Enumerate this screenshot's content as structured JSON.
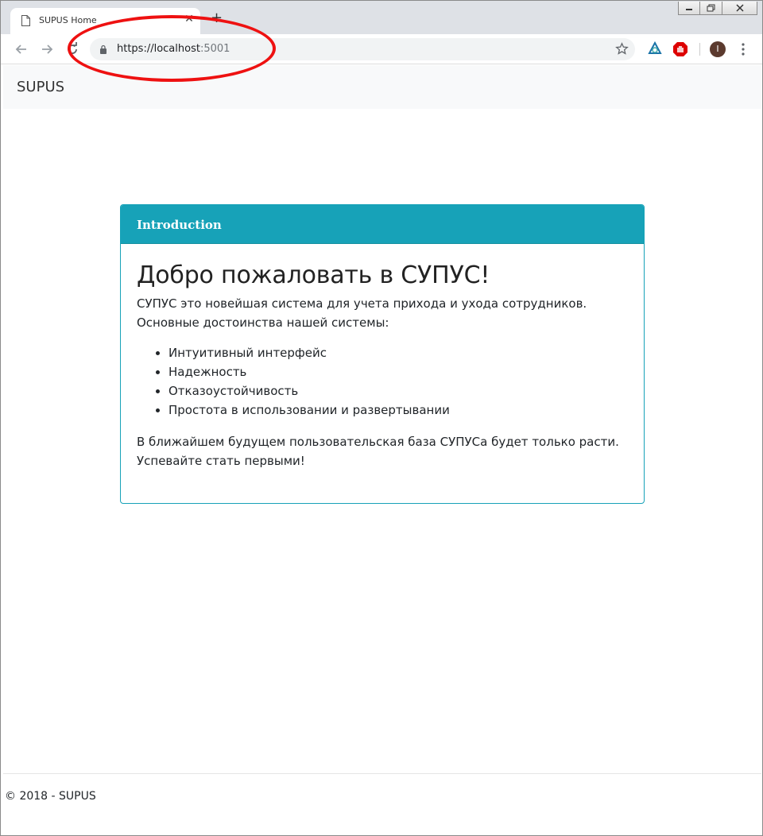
{
  "browser": {
    "tab_title": "SUPUS Home",
    "url_main": "https://localhost",
    "url_port": ":5001",
    "avatar_initial": "I"
  },
  "navbar": {
    "brand": "SUPUS"
  },
  "card": {
    "header": "Introduction",
    "heading": "Добро пожаловать в СУПУС!",
    "intro": "СУПУС это новейшая система для учета прихода и ухода сотрудников. Основные достоинства нашей системы:",
    "features": [
      "Интуитивный интерфейс",
      "Надежность",
      "Отказоустойчивость",
      "Простота в использовании и развертывании"
    ],
    "closing": "В ближайшем будущем пользовательская база СУПУСа будет только расти. Успевайте стать первыми!"
  },
  "footer": {
    "text": "© 2018 - SUPUS"
  },
  "colors": {
    "accent": "#17a2b8",
    "annotation": "#ee1111",
    "navbar_bg": "#f8f9fa"
  }
}
